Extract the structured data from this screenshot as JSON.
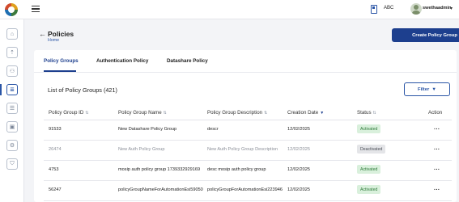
{
  "header": {
    "org": "ABC",
    "username": "swethaadmin",
    "user_caret": "▾"
  },
  "sidebar": {
    "items": [
      {
        "icon": "home-icon"
      },
      {
        "icon": "document-upload-icon"
      },
      {
        "icon": "users-icon"
      },
      {
        "icon": "policy-icon",
        "active": true
      },
      {
        "icon": "list-check-icon"
      },
      {
        "icon": "id-card-icon"
      },
      {
        "icon": "settings-icon"
      },
      {
        "icon": "shield-icon"
      }
    ]
  },
  "page": {
    "back_arrow": "←",
    "title": "Policies",
    "breadcrumb": "Home",
    "create_button": "Create Policy Group"
  },
  "tabs": [
    {
      "label": "Policy Groups",
      "active": true
    },
    {
      "label": "Authentication Policy"
    },
    {
      "label": "Datashare Policy"
    }
  ],
  "list": {
    "title": "List of Policy Groups (421)",
    "filter_label": "Filter",
    "filter_caret": "▼"
  },
  "table": {
    "columns": [
      {
        "label": "Policy Group ID",
        "sort": "⇅"
      },
      {
        "label": "Policy Group Name",
        "sort": "⇅"
      },
      {
        "label": "Policy Group Description",
        "sort": "⇅"
      },
      {
        "label": "Creation Date",
        "sort": "▼"
      },
      {
        "label": "Status",
        "sort": "⇅"
      },
      {
        "label": "Action",
        "sort": ""
      }
    ],
    "rows": [
      {
        "id": "91533",
        "name": "New Datashare Policy Group",
        "description": "descr",
        "date": "12/02/2025",
        "status": "Activated",
        "action": "..."
      },
      {
        "id": "26474",
        "name": "New Auth Policy Group",
        "description": "New Auth Policy Group Description",
        "date": "12/02/2025",
        "status": "Deactivated",
        "action": "..."
      },
      {
        "id": "4753",
        "name": "mosip auth policy group 1739332929169",
        "description": "desc mosip auth policy group",
        "date": "12/02/2025",
        "status": "Activated",
        "action": "..."
      },
      {
        "id": "56247",
        "name": "policyGroupNameForAutomationEsi59050",
        "description": "policyGroupForAutomationEsi223946",
        "date": "12/02/2025",
        "status": "Activated",
        "action": "..."
      }
    ]
  },
  "colors": {
    "primary": "#1d3f8e",
    "active_badge_bg": "#d9f0dc",
    "active_badge_text": "#2f7a3a",
    "inactive_badge_bg": "#e4e5e8"
  }
}
